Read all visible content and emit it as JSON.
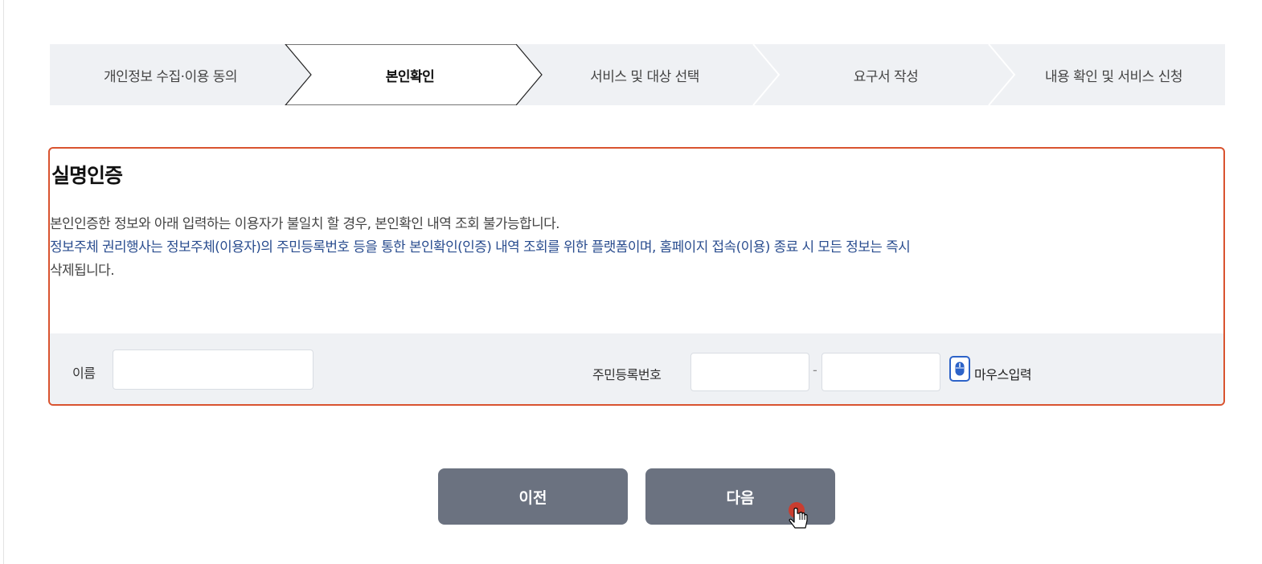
{
  "steps": [
    {
      "label": "개인정보 수집·이용 동의",
      "active": false
    },
    {
      "label": "본인확인",
      "active": true
    },
    {
      "label": "서비스 및 대상 선택",
      "active": false
    },
    {
      "label": "요구서 작성",
      "active": false
    },
    {
      "label": "내용 확인 및 서비스 신청",
      "active": false
    }
  ],
  "verification": {
    "title": "실명인증",
    "notice": "본인인증한 정보와 아래 입력하는 이용자가 불일치 할 경우, 본인확인 내역 조회 불가능합니다.",
    "info_line1": "정보주체 권리행사는 정보주체(이용자)의 주민등록번호 등을 통한 본인확인(인증) 내역 조회를 위한 플랫폼이며, 홈페이지 접속(이용) 종료 시 모든 정보는 즉시",
    "info_line2": "삭제됩니다.",
    "name_label": "이름",
    "name_value": "",
    "rrn_label": "주민등록번호",
    "rrn_front_value": "",
    "rrn_back_value": "",
    "rrn_separator": "-",
    "mouse_input_label": "마우스입력"
  },
  "buttons": {
    "prev_label": "이전",
    "next_label": "다음"
  },
  "colors": {
    "accent_border": "#d9532f",
    "info_text": "#2a4d8f",
    "button_bg": "#6b7280",
    "mouse_icon": "#2d63c8"
  }
}
